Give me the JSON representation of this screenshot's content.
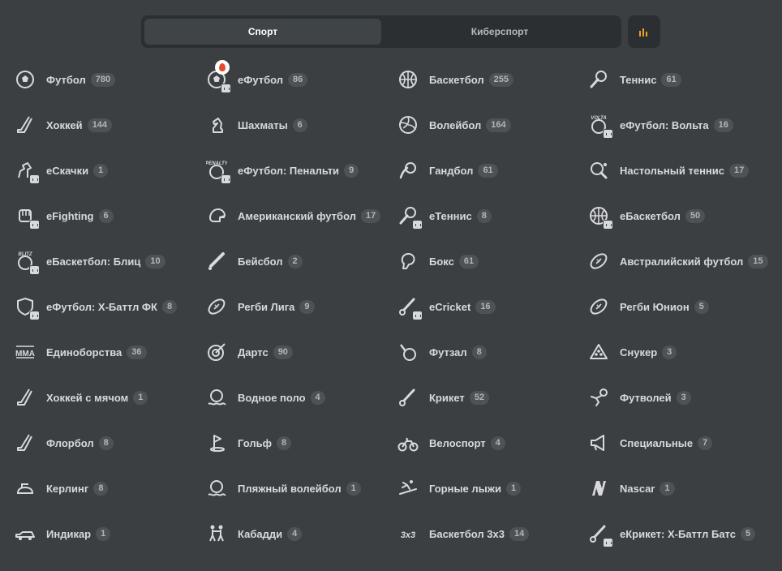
{
  "tabs": [
    {
      "label": "Спорт",
      "active": true
    },
    {
      "label": "Киберспорт",
      "active": false
    }
  ],
  "stats_icon": "bar-chart-icon",
  "accent_color": "#f0a11d",
  "sports": [
    {
      "label": "Футбол",
      "count": "780",
      "icon": "football-icon"
    },
    {
      "label": "еФутбол",
      "count": "86",
      "icon": "efootball-icon",
      "hot": true,
      "esport": true
    },
    {
      "label": "Баскетбол",
      "count": "255",
      "icon": "basketball-icon"
    },
    {
      "label": "Теннис",
      "count": "61",
      "icon": "tennis-icon"
    },
    {
      "label": "Хоккей",
      "count": "144",
      "icon": "hockey-icon"
    },
    {
      "label": "Шахматы",
      "count": "6",
      "icon": "chess-icon"
    },
    {
      "label": "Волейбол",
      "count": "164",
      "icon": "volleyball-icon"
    },
    {
      "label": "еФутбол: Вольта",
      "count": "16",
      "icon": "volta-icon",
      "esport": true
    },
    {
      "label": "еСкачки",
      "count": "1",
      "icon": "horse-racing-icon",
      "esport": true
    },
    {
      "label": "еФутбол: Пенальти",
      "count": "9",
      "icon": "penalty-icon",
      "esport": true
    },
    {
      "label": "Гандбол",
      "count": "61",
      "icon": "handball-icon"
    },
    {
      "label": "Настольный теннис",
      "count": "17",
      "icon": "table-tennis-icon"
    },
    {
      "label": "eFighting",
      "count": "6",
      "icon": "fist-icon",
      "esport": true
    },
    {
      "label": "Американский футбол",
      "count": "17",
      "icon": "football-helmet-icon"
    },
    {
      "label": "еТеннис",
      "count": "8",
      "icon": "etennis-icon",
      "esport": true
    },
    {
      "label": "еБаскетбол",
      "count": "50",
      "icon": "ebasketball-icon",
      "esport": true
    },
    {
      "label": "еБаскетбол: Блиц",
      "count": "10",
      "icon": "blitz-icon",
      "esport": true
    },
    {
      "label": "Бейсбол",
      "count": "2",
      "icon": "baseball-bat-icon"
    },
    {
      "label": "Бокс",
      "count": "61",
      "icon": "boxing-glove-icon"
    },
    {
      "label": "Австралийский футбол",
      "count": "15",
      "icon": "aussie-ball-icon"
    },
    {
      "label": "еФутбол: Х-Баттл ФК",
      "count": "8",
      "icon": "xbattle-shield-icon",
      "esport": true
    },
    {
      "label": "Регби Лига",
      "count": "9",
      "icon": "rugby-ball-icon"
    },
    {
      "label": "eCricket",
      "count": "16",
      "icon": "ecricket-icon",
      "esport": true
    },
    {
      "label": "Регби Юнион",
      "count": "5",
      "icon": "rugby-union-icon"
    },
    {
      "label": "Единоборства",
      "count": "36",
      "icon": "mma-icon"
    },
    {
      "label": "Дартс",
      "count": "90",
      "icon": "darts-icon"
    },
    {
      "label": "Футзал",
      "count": "8",
      "icon": "futsal-icon"
    },
    {
      "label": "Снукер",
      "count": "3",
      "icon": "snooker-icon"
    },
    {
      "label": "Хоккей с мячом",
      "count": "1",
      "icon": "bandy-icon"
    },
    {
      "label": "Водное поло",
      "count": "4",
      "icon": "water-polo-icon"
    },
    {
      "label": "Крикет",
      "count": "52",
      "icon": "cricket-icon"
    },
    {
      "label": "Футволей",
      "count": "3",
      "icon": "footvolley-icon"
    },
    {
      "label": "Флорбол",
      "count": "8",
      "icon": "floorball-icon"
    },
    {
      "label": "Гольф",
      "count": "8",
      "icon": "golf-icon"
    },
    {
      "label": "Велоспорт",
      "count": "4",
      "icon": "cycling-icon"
    },
    {
      "label": "Специальные",
      "count": "7",
      "icon": "megaphone-icon"
    },
    {
      "label": "Керлинг",
      "count": "8",
      "icon": "curling-icon"
    },
    {
      "label": "Пляжный волейбол",
      "count": "1",
      "icon": "beach-volleyball-icon"
    },
    {
      "label": "Горные лыжи",
      "count": "1",
      "icon": "skiing-icon"
    },
    {
      "label": "Nascar",
      "count": "1",
      "icon": "nascar-icon"
    },
    {
      "label": "Индикар",
      "count": "1",
      "icon": "indycar-icon"
    },
    {
      "label": "Кабадди",
      "count": "4",
      "icon": "kabaddi-icon"
    },
    {
      "label": "Баскетбол 3х3",
      "count": "14",
      "icon": "basketball-3x3-icon"
    },
    {
      "label": "еКрикет: Х-Баттл Батс",
      "count": "5",
      "icon": "ecricket-xbattle-icon",
      "esport": true
    }
  ]
}
